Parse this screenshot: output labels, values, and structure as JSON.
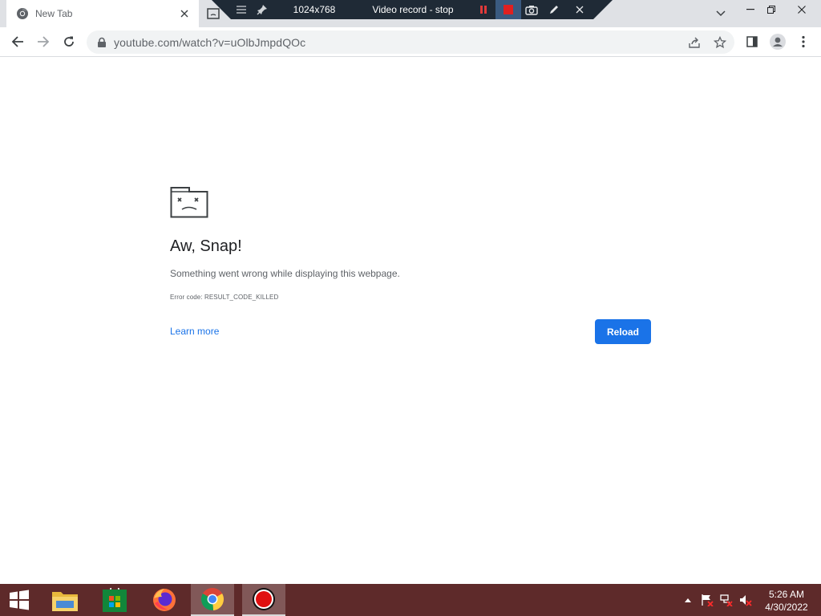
{
  "browser": {
    "tab": {
      "title": "New Tab"
    },
    "omnibox": {
      "url": "youtube.com/watch?v=uOlbJmpdQOc"
    }
  },
  "recorder": {
    "resolution": "1024x768",
    "status": "Video record - stop"
  },
  "error_page": {
    "heading": "Aw, Snap!",
    "message": "Something went wrong while displaying this webpage.",
    "error_code": "Error code: RESULT_CODE_KILLED",
    "learn_more": "Learn more",
    "reload": "Reload"
  },
  "taskbar": {
    "time": "5:26 AM",
    "date": "4/30/2022",
    "apps": [
      "start-icon",
      "file-explorer-icon",
      "store-icon",
      "firefox-icon",
      "chrome-icon",
      "recorder-icon"
    ]
  },
  "colors": {
    "accent": "#1a73e8",
    "taskbar": "#5e2a2a",
    "recorder_bar": "#1f2a36"
  }
}
